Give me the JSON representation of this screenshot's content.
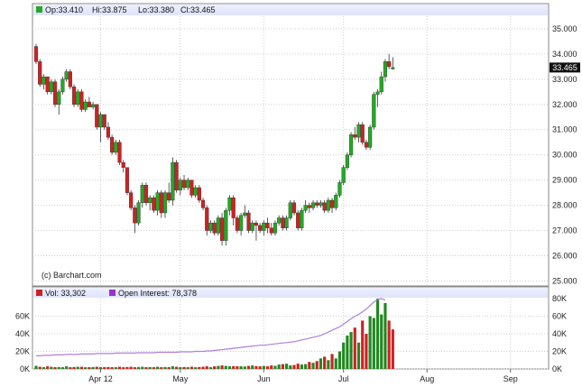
{
  "chart_data": {
    "type": "candlestick",
    "price_panel": {
      "header": {
        "open_label": "Op:33.410",
        "high_label": "Hi:33.875",
        "low_label": "Lo:33.380",
        "close_label": "Cl:33.465"
      },
      "last_price_label": "33.465",
      "watermark": "(c) Barchart.com",
      "ylim": [
        24.8,
        35.5
      ],
      "yticks": [
        "35.000",
        "34.000",
        "33.000",
        "32.000",
        "31.000",
        "30.000",
        "29.000",
        "28.000",
        "27.000",
        "26.000",
        "25.000"
      ],
      "colors": {
        "up": "#22aa22",
        "down": "#cc2222"
      },
      "candles": [
        [
          34.3,
          34.4,
          33.6,
          33.7
        ],
        [
          33.7,
          33.8,
          32.7,
          32.8
        ],
        [
          32.8,
          33.2,
          32.6,
          33.1
        ],
        [
          33.1,
          33.1,
          32.4,
          32.5
        ],
        [
          32.5,
          33.0,
          32.4,
          32.9
        ],
        [
          32.9,
          33.0,
          31.9,
          32.0
        ],
        [
          32.0,
          32.6,
          31.6,
          32.5
        ],
        [
          32.5,
          33.1,
          32.4,
          33.0
        ],
        [
          33.0,
          33.4,
          32.9,
          33.3
        ],
        [
          33.3,
          33.4,
          32.6,
          32.7
        ],
        [
          32.7,
          32.8,
          31.9,
          32.0
        ],
        [
          32.0,
          32.6,
          31.9,
          32.5
        ],
        [
          32.5,
          32.6,
          31.7,
          31.8
        ],
        [
          31.8,
          32.2,
          31.7,
          32.1
        ],
        [
          32.1,
          32.3,
          31.9,
          31.9
        ],
        [
          31.9,
          32.1,
          31.8,
          32.0
        ],
        [
          32.0,
          32.0,
          31.0,
          31.1
        ],
        [
          31.1,
          31.7,
          30.5,
          31.6
        ],
        [
          31.6,
          31.6,
          31.0,
          31.1
        ],
        [
          31.1,
          31.3,
          30.6,
          30.7
        ],
        [
          30.7,
          30.8,
          30.0,
          30.1
        ],
        [
          30.1,
          30.6,
          30.0,
          30.5
        ],
        [
          30.5,
          30.6,
          29.6,
          29.7
        ],
        [
          29.7,
          29.8,
          29.3,
          29.5
        ],
        [
          29.5,
          29.5,
          28.4,
          28.5
        ],
        [
          28.5,
          28.6,
          27.8,
          27.9
        ],
        [
          27.9,
          28.0,
          26.9,
          27.3
        ],
        [
          27.3,
          28.2,
          27.2,
          28.1
        ],
        [
          28.1,
          28.9,
          27.9,
          28.8
        ],
        [
          28.8,
          28.9,
          28.0,
          28.1
        ],
        [
          28.1,
          28.4,
          27.8,
          28.3
        ],
        [
          28.3,
          28.4,
          27.7,
          27.8
        ],
        [
          27.8,
          28.6,
          27.6,
          28.5
        ],
        [
          28.5,
          28.6,
          27.5,
          27.7
        ],
        [
          27.7,
          28.6,
          27.5,
          28.5
        ],
        [
          28.5,
          28.9,
          28.1,
          28.2
        ],
        [
          28.2,
          29.9,
          28.0,
          29.7
        ],
        [
          29.7,
          29.8,
          28.5,
          28.6
        ],
        [
          28.6,
          29.1,
          28.4,
          29.0
        ],
        [
          29.0,
          29.2,
          28.6,
          28.7
        ],
        [
          28.7,
          29.1,
          28.6,
          29.0
        ],
        [
          29.0,
          29.0,
          28.3,
          28.4
        ],
        [
          28.4,
          28.8,
          28.3,
          28.7
        ],
        [
          28.7,
          28.8,
          28.1,
          28.2
        ],
        [
          28.2,
          28.3,
          27.8,
          27.9
        ],
        [
          27.9,
          28.0,
          26.8,
          27.0
        ],
        [
          27.0,
          27.4,
          26.9,
          27.3
        ],
        [
          27.3,
          27.4,
          26.8,
          26.9
        ],
        [
          26.9,
          27.6,
          26.8,
          27.5
        ],
        [
          27.5,
          27.7,
          26.4,
          26.6
        ],
        [
          26.6,
          27.9,
          26.4,
          27.8
        ],
        [
          27.8,
          28.4,
          27.6,
          28.3
        ],
        [
          28.3,
          28.4,
          27.2,
          27.5
        ],
        [
          27.5,
          27.6,
          26.9,
          27.0
        ],
        [
          27.0,
          27.7,
          26.8,
          27.6
        ],
        [
          27.6,
          28.0,
          27.5,
          27.7
        ],
        [
          27.7,
          27.8,
          26.9,
          27.0
        ],
        [
          27.0,
          27.4,
          26.9,
          27.3
        ],
        [
          27.3,
          27.4,
          26.6,
          27.2
        ],
        [
          27.2,
          27.3,
          26.9,
          27.0
        ],
        [
          27.0,
          27.4,
          26.8,
          27.3
        ],
        [
          27.3,
          27.5,
          26.9,
          27.1
        ],
        [
          27.1,
          27.3,
          26.8,
          26.9
        ],
        [
          26.9,
          27.4,
          26.8,
          27.3
        ],
        [
          27.3,
          27.6,
          27.2,
          27.5
        ],
        [
          27.5,
          27.6,
          27.0,
          27.1
        ],
        [
          27.1,
          27.6,
          27.0,
          27.5
        ],
        [
          27.5,
          28.2,
          27.4,
          28.1
        ],
        [
          28.1,
          28.2,
          27.6,
          27.7
        ],
        [
          27.7,
          27.8,
          27.0,
          27.1
        ],
        [
          27.1,
          27.9,
          27.0,
          27.8
        ],
        [
          27.8,
          28.2,
          27.7,
          28.0
        ],
        [
          28.0,
          28.1,
          27.7,
          27.9
        ],
        [
          27.9,
          28.2,
          27.8,
          28.1
        ],
        [
          28.1,
          28.2,
          27.9,
          28.0
        ],
        [
          28.0,
          28.2,
          27.9,
          28.1
        ],
        [
          28.1,
          28.2,
          27.7,
          27.8
        ],
        [
          27.8,
          28.3,
          27.7,
          28.2
        ],
        [
          28.2,
          28.3,
          27.7,
          27.9
        ],
        [
          27.9,
          28.5,
          27.8,
          28.4
        ],
        [
          28.4,
          29.0,
          28.3,
          28.9
        ],
        [
          28.9,
          29.6,
          28.8,
          29.5
        ],
        [
          29.5,
          30.1,
          29.4,
          30.0
        ],
        [
          30.0,
          30.9,
          29.9,
          30.8
        ],
        [
          30.8,
          31.1,
          30.6,
          30.7
        ],
        [
          30.7,
          31.3,
          30.5,
          31.2
        ],
        [
          31.2,
          31.3,
          30.4,
          30.5
        ],
        [
          30.5,
          30.6,
          30.2,
          30.3
        ],
        [
          30.3,
          31.2,
          30.2,
          31.1
        ],
        [
          31.1,
          32.5,
          31.0,
          32.4
        ],
        [
          32.4,
          32.6,
          31.9,
          32.5
        ],
        [
          32.5,
          33.3,
          32.4,
          33.1
        ],
        [
          33.1,
          33.8,
          32.9,
          33.7
        ],
        [
          33.7,
          34.0,
          33.4,
          33.5
        ],
        [
          33.41,
          33.875,
          33.38,
          33.465
        ]
      ]
    },
    "volume_panel": {
      "vol_label": "Vol: 33,302",
      "oi_label": "Open Interest: 78,378",
      "colors": {
        "vol": "#cc2222",
        "oi": "#9933cc"
      },
      "ylim": [
        0,
        80000
      ],
      "left_ticks": [
        "60K",
        "40K",
        "20K",
        "0K"
      ],
      "right_ticks": [
        "80K",
        "60K",
        "40K",
        "20K",
        "0K"
      ],
      "volume": [
        3500,
        2500,
        2000,
        3000,
        2500,
        2000,
        2200,
        2000,
        3000,
        2000,
        2200,
        2500,
        2500,
        2000,
        2000,
        2200,
        2500,
        2000,
        2000,
        2200,
        2000,
        2000,
        2500,
        2000,
        2200,
        2500,
        2000,
        2200,
        2500,
        2000,
        2200,
        2000,
        2500,
        2000,
        2200,
        2000,
        3000,
        2500,
        2000,
        2200,
        2000,
        2500,
        2000,
        2200,
        2500,
        3000,
        2000,
        3000,
        3500,
        4000,
        3500,
        3000,
        3200,
        3000,
        3000,
        2800,
        3500,
        4000,
        3200,
        3000,
        3500,
        3000,
        4000,
        3500,
        5000,
        5500,
        6000,
        4000,
        4500,
        6000,
        5000,
        5500,
        8000,
        7000,
        9000,
        12000,
        14000,
        10000,
        17000,
        12000,
        20000,
        30000,
        38000,
        42000,
        47000,
        30000,
        55000,
        40000,
        60000,
        58000,
        80000,
        62000,
        75000,
        55000,
        45000
      ],
      "vol_up": [
        true,
        false,
        true,
        false,
        true,
        false,
        true,
        true,
        true,
        false,
        false,
        true,
        false,
        true,
        false,
        true,
        false,
        true,
        false,
        false,
        false,
        true,
        false,
        false,
        false,
        false,
        false,
        true,
        true,
        false,
        true,
        false,
        true,
        false,
        true,
        false,
        true,
        false,
        true,
        false,
        true,
        false,
        true,
        false,
        false,
        false,
        true,
        false,
        true,
        false,
        true,
        true,
        false,
        false,
        true,
        true,
        false,
        true,
        false,
        false,
        true,
        false,
        false,
        true,
        true,
        false,
        true,
        true,
        false,
        false,
        true,
        true,
        false,
        true,
        false,
        true,
        false,
        true,
        false,
        true,
        true,
        true,
        true,
        true,
        false,
        true,
        false,
        false,
        true,
        true,
        true,
        true,
        true,
        false,
        false
      ],
      "open_interest": [
        15000,
        15000,
        15500,
        15500,
        15500,
        16000,
        16000,
        16000,
        16500,
        16500,
        16500,
        16500,
        17000,
        17000,
        17000,
        17000,
        17500,
        17500,
        17500,
        17500,
        17500,
        18000,
        18000,
        18000,
        18000,
        18000,
        18000,
        18500,
        18500,
        18500,
        18500,
        18500,
        19000,
        19000,
        19000,
        19000,
        19000,
        19000,
        19500,
        19500,
        19500,
        19500,
        20000,
        20000,
        20000,
        20500,
        20500,
        21000,
        21500,
        22000,
        22500,
        23000,
        23500,
        24000,
        24500,
        25000,
        25500,
        26000,
        26500,
        27000,
        27000,
        27500,
        28000,
        28500,
        29000,
        29500,
        30000,
        30500,
        31000,
        32000,
        33000,
        34000,
        35000,
        36000,
        37000,
        38000,
        40000,
        42000,
        44000,
        46000,
        48000,
        51000,
        54000,
        57000,
        60000,
        62000,
        65000,
        68000,
        72000,
        76000,
        79000,
        80000,
        78378
      ]
    },
    "x_axis": {
      "labels": [
        {
          "text": "Apr 12",
          "index": 17
        },
        {
          "text": "May",
          "index": 38
        },
        {
          "text": "Jun",
          "index": 60
        },
        {
          "text": "Jul",
          "index": 81
        },
        {
          "text": "Aug",
          "index": 103
        },
        {
          "text": "Sep",
          "index": 125
        }
      ],
      "total_slots": 136
    }
  }
}
